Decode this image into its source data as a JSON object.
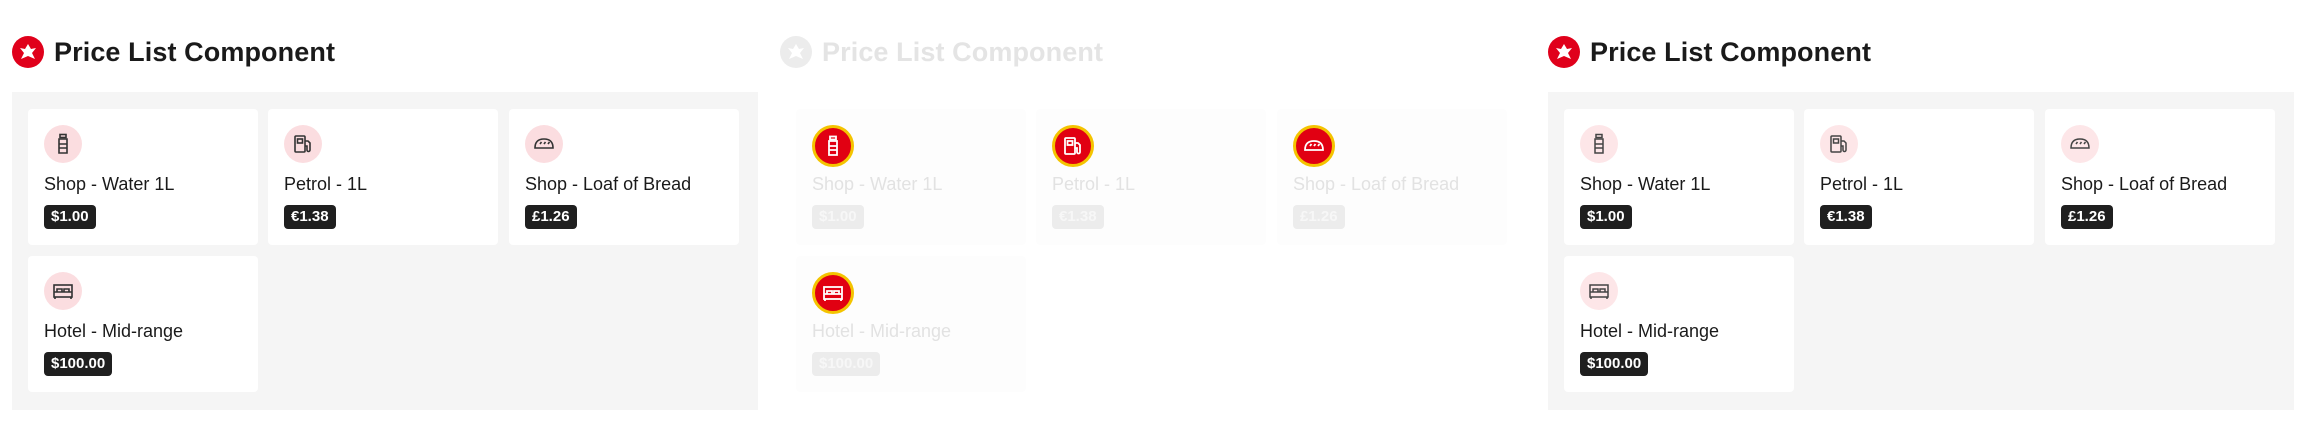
{
  "panels": [
    {
      "title": "Price List Component",
      "items": [
        {
          "label": "Shop - Water 1L",
          "price": "$1.00",
          "icon": "water-bottle-icon"
        },
        {
          "label": "Petrol - 1L",
          "price": "€1.38",
          "icon": "fuel-pump-icon"
        },
        {
          "label": "Shop - Loaf of Bread",
          "price": "£1.26",
          "icon": "bread-icon"
        },
        {
          "label": "Hotel - Mid-range",
          "price": "$100.00",
          "icon": "bed-icon"
        }
      ]
    },
    {
      "title": "Price List Component",
      "items": [
        {
          "label": "Shop - Water 1L",
          "price": "$1.00",
          "icon": "water-bottle-icon"
        },
        {
          "label": "Petrol - 1L",
          "price": "€1.38",
          "icon": "fuel-pump-icon"
        },
        {
          "label": "Shop - Loaf of Bread",
          "price": "£1.26",
          "icon": "bread-icon"
        },
        {
          "label": "Hotel - Mid-range",
          "price": "$100.00",
          "icon": "bed-icon"
        }
      ]
    },
    {
      "title": "Price List Component",
      "items": [
        {
          "label": "Shop - Water 1L",
          "price": "$1.00",
          "icon": "water-bottle-icon"
        },
        {
          "label": "Petrol - 1L",
          "price": "€1.38",
          "icon": "fuel-pump-icon"
        },
        {
          "label": "Shop - Loaf of Bread",
          "price": "£1.26",
          "icon": "bread-icon"
        },
        {
          "label": "Hotel - Mid-range",
          "price": "$100.00",
          "icon": "bed-icon"
        }
      ]
    }
  ],
  "colors": {
    "brand_red": "#e0001b",
    "price_badge": "#1f1f1f",
    "grid_background": "#f5f5f5",
    "icon_circle": "#fbdde0"
  }
}
